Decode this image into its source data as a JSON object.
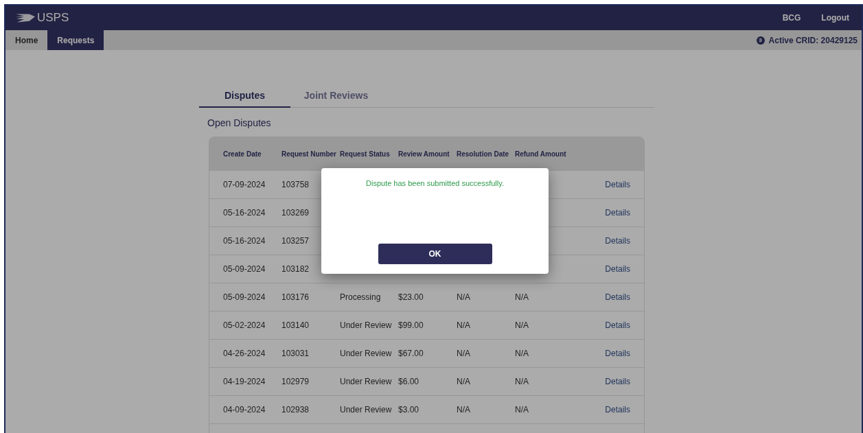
{
  "header": {
    "logo": "USPS",
    "links": [
      "BCG",
      "Logout"
    ]
  },
  "nav": {
    "items": [
      {
        "label": "Home",
        "selected": false
      },
      {
        "label": "Requests",
        "selected": true
      }
    ],
    "crid_badge": "3",
    "crid": "Active CRID: 20429125"
  },
  "tabs": [
    {
      "label": "Disputes",
      "selected": true
    },
    {
      "label": "Joint Reviews",
      "selected": false
    }
  ],
  "section_title": "Open Disputes",
  "table": {
    "columns": [
      "Create Date",
      "Request Number",
      "Request Status",
      "Review Amount",
      "Resolution Date",
      "Refund Amount"
    ],
    "rows": [
      {
        "create_date": "07-09-2024",
        "request_number": "103758",
        "link": "Details"
      },
      {
        "create_date": "05-16-2024",
        "request_number": "103269",
        "link": "Details"
      },
      {
        "create_date": "05-16-2024",
        "request_number": "103257",
        "link": "Details"
      },
      {
        "create_date": "05-09-2024",
        "request_number": "103182",
        "link": "Details"
      },
      {
        "create_date": "05-09-2024",
        "request_number": "103176",
        "request_status": "Processing",
        "review_amount": "$23.00",
        "resolution_date": "N/A",
        "refund_amount": "N/A",
        "link": "Details"
      },
      {
        "create_date": "05-02-2024",
        "request_number": "103140",
        "request_status": "Under Review",
        "review_amount": "$99.00",
        "resolution_date": "N/A",
        "refund_amount": "N/A",
        "link": "Details"
      },
      {
        "create_date": "04-26-2024",
        "request_number": "103031",
        "request_status": "Under Review",
        "review_amount": "$67.00",
        "resolution_date": "N/A",
        "refund_amount": "N/A",
        "link": "Details"
      },
      {
        "create_date": "04-19-2024",
        "request_number": "102979",
        "request_status": "Under Review",
        "review_amount": "$6.00",
        "resolution_date": "N/A",
        "refund_amount": "N/A",
        "link": "Details"
      },
      {
        "create_date": "04-09-2024",
        "request_number": "102938",
        "request_status": "Under Review",
        "review_amount": "$3.00",
        "resolution_date": "N/A",
        "refund_amount": "N/A",
        "link": "Details"
      }
    ]
  },
  "dialog": {
    "message": "Dispute has been submitted successfully.",
    "button": "OK"
  }
}
